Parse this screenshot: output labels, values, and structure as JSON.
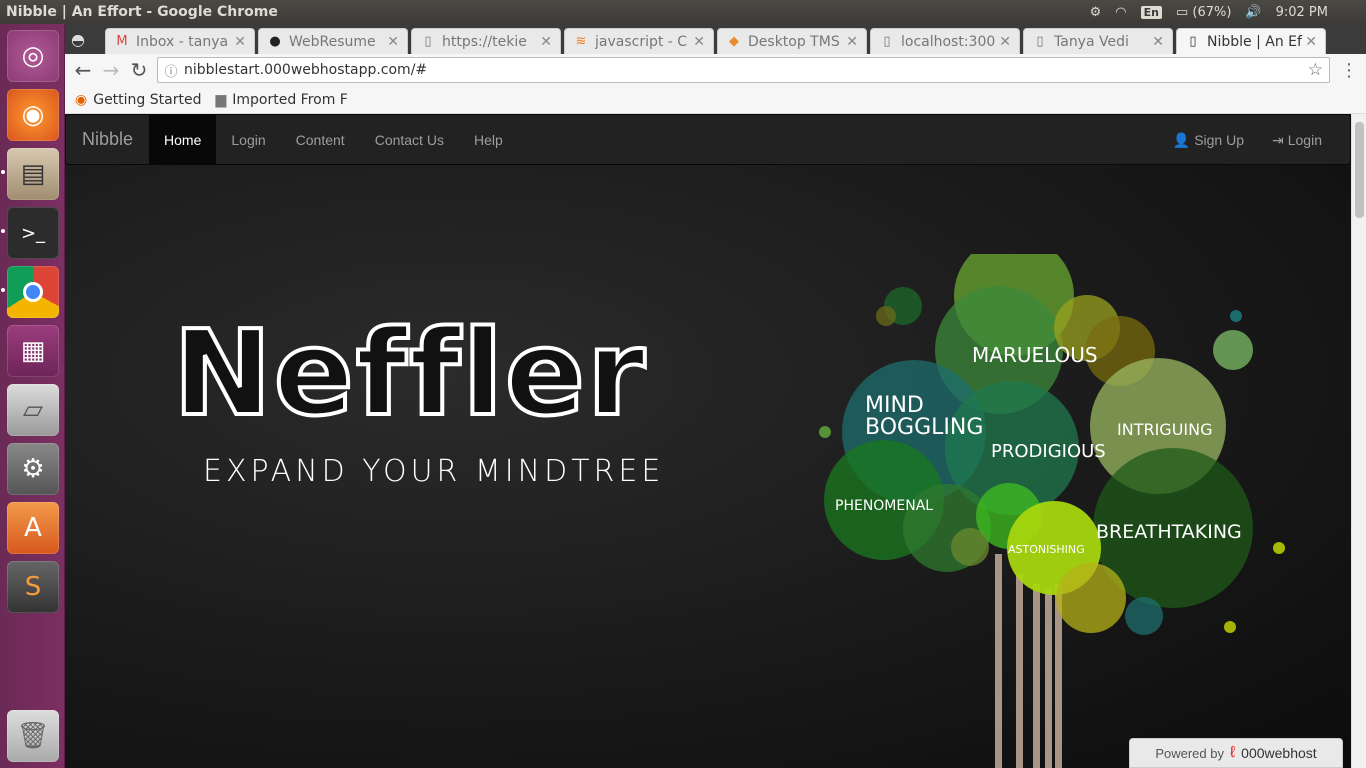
{
  "system": {
    "window_title": "Nibble | An Effort - Google Chrome",
    "keyboard": "En",
    "battery": "(67%)",
    "time": "9:02 PM"
  },
  "launcher": {
    "items": [
      "Ubuntu Dash",
      "Firefox",
      "Files",
      "Terminal",
      "Chrome",
      "Workspaces",
      "Disks",
      "System Settings",
      "Software Center",
      "Sublime Text",
      "Trash"
    ]
  },
  "tabs": [
    {
      "label": "Inbox - tanya",
      "icon": "gmail-icon"
    },
    {
      "label": "WebResume",
      "icon": "github-icon"
    },
    {
      "label": "https://tekie",
      "icon": "page-icon"
    },
    {
      "label": "javascript - C",
      "icon": "stackoverflow-icon"
    },
    {
      "label": "Desktop TMS",
      "icon": "app-icon"
    },
    {
      "label": "localhost:300",
      "icon": "page-icon"
    },
    {
      "label": "Tanya Vedi",
      "icon": "page-icon"
    },
    {
      "label": "Nibble | An Ef",
      "icon": "page-icon"
    }
  ],
  "omnibox": {
    "url": "nibblestart.000webhostapp.com/#"
  },
  "bookmarks": [
    {
      "label": "Getting Started",
      "icon": "firefox-icon"
    },
    {
      "label": "Imported From F",
      "icon": "folder-icon"
    }
  ],
  "site": {
    "brand": "Nibble",
    "nav": [
      "Home",
      "Login",
      "Content",
      "Contact Us",
      "Help"
    ],
    "nav_active": "Home",
    "nav_right": [
      "Sign Up",
      "Login"
    ],
    "hero_title": "Neffler",
    "hero_subtitle": "EXPAND YOUR MINDTREE",
    "tree_words": [
      "MARUELOUS",
      "MIND",
      "BOGGLING",
      "PRODIGIOUS",
      "INTRIGUING",
      "PHENOMENAL",
      "ASTONISHING",
      "BREATHTAKING"
    ],
    "powered_by": "Powered by",
    "powered_host": "000webhost"
  }
}
